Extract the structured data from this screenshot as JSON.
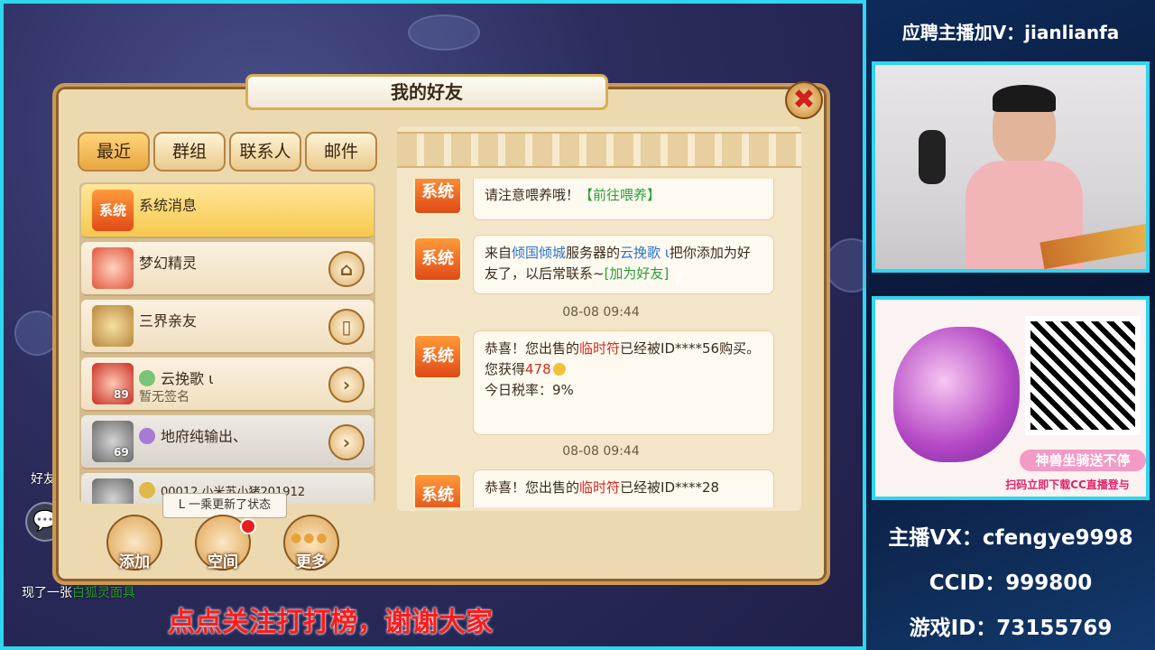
{
  "dialog": {
    "title": "我的好友",
    "close_label": "✖",
    "tabs": [
      "最近",
      "群组",
      "联系人",
      "邮件"
    ]
  },
  "friends": [
    {
      "name": "系统消息",
      "sub": "",
      "level": ""
    },
    {
      "name": "梦幻精灵",
      "sub": "",
      "level": ""
    },
    {
      "name": "三界亲友",
      "sub": "",
      "level": ""
    },
    {
      "name": "云挽歌 ι",
      "sub": "暂无签名",
      "level": "89"
    },
    {
      "name": "地府纯输出、",
      "sub": "",
      "level": "69"
    },
    {
      "name": "00012 小米苏小猪201912",
      "sub": "",
      "level": ""
    }
  ],
  "tooltip": "L 一乘更新了状态",
  "actions": {
    "add": "添加",
    "space": "空间",
    "more": "更多"
  },
  "messages": {
    "sender_label": "系统",
    "msg1_line1": "请注意喂养哦！",
    "msg1_link": "【前往喂养】",
    "msg2_pre": "来自",
    "msg2_server": "倾国倾城",
    "msg2_mid": "服务器的",
    "msg2_name": "云挽歌 ι",
    "msg2_post": "把你添加为好友了，以后常联系~",
    "msg2_link": "[加为好友]",
    "time1": "08-08 09:44",
    "msg3_pre": "恭喜！您出售的",
    "msg3_item": "临时符",
    "msg3_post": "已经被ID****56购买。",
    "msg3_gain_pre": "您获得",
    "msg3_gain": "478",
    "msg3_tax": "今日税率：9%",
    "time2": "08-08 09:44",
    "msg4_pre": "恭喜！您出售的",
    "msg4_item": "临时符",
    "msg4_post": "已经被ID****28"
  },
  "chat": {
    "line1": "好友",
    "line2": "现了一张",
    "line2_item": "白狐灵面具"
  },
  "overlay": {
    "bottom_banner": "点点关注打打榜，谢谢大家"
  },
  "side": {
    "recruit": "应聘主播加V：jianlianfa",
    "ad_banner": "神兽坐骑送不停",
    "ad_sub": "扫码立即下载CC直播登与",
    "vx": "主播VX：cfengye9998",
    "ccid": "CCID：999800",
    "game_id": "游戏ID：73155769"
  },
  "colors": {
    "frame_cyan": "#2fd6ef",
    "banner_red": "#ff1a1a",
    "link_blue": "#2d74c8",
    "link_green": "#2a9d3a"
  }
}
